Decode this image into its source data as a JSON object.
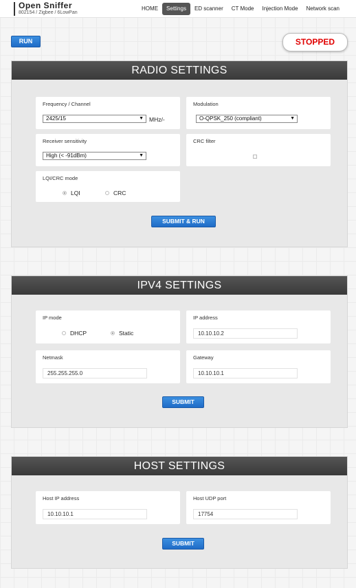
{
  "brand": {
    "title": "Open Sniffer",
    "subtitle": "802154 / Zigbee / 6LowPan"
  },
  "nav": [
    {
      "label": "HOME"
    },
    {
      "label": "Settings",
      "active": true
    },
    {
      "label": "ED scanner"
    },
    {
      "label": "CT Mode"
    },
    {
      "label": "Injection Mode"
    },
    {
      "label": "Network scan"
    }
  ],
  "controls": {
    "run_label": "RUN",
    "status": "STOPPED",
    "status_color": "#e00000"
  },
  "radio": {
    "title": "RADIO SETTINGS",
    "frequency_label": "Frequency / Channel",
    "frequency_value": "2425/15",
    "frequency_unit": "MHz/-",
    "modulation_label": "Modulation",
    "modulation_value": "O-QPSK_250 (compliant)",
    "sensitivity_label": "Receiver sensitivity",
    "sensitivity_value": "High (< -91dBm)",
    "crc_filter_label": "CRC filter",
    "crc_filter_checked": false,
    "lqi_crc_label": "LQI/CRC mode",
    "lqi_option": "LQI",
    "crc_option": "CRC",
    "lqi_crc_selected": "LQI",
    "submit_label": "SUBMIT & RUN"
  },
  "ipv4": {
    "title": "IPV4 SETTINGS",
    "ip_mode_label": "IP mode",
    "dhcp_option": "DHCP",
    "static_option": "Static",
    "ip_mode_selected": "Static",
    "ip_address_label": "IP address",
    "ip_address_value": "10.10.10.2",
    "netmask_label": "Netmask",
    "netmask_value": "255.255.255.0",
    "gateway_label": "Gateway",
    "gateway_value": "10.10.10.1",
    "submit_label": "SUBMIT"
  },
  "host": {
    "title": "HOST SETTINGS",
    "host_ip_label": "Host IP address",
    "host_ip_value": "10.10.10.1",
    "host_port_label": "Host UDP port",
    "host_port_value": "17754",
    "submit_label": "SUBMIT"
  },
  "colors": {
    "accent": "#1f6cc7",
    "header_bg": "#444444"
  },
  "icons": {
    "dropdown": "chevron-down-icon"
  }
}
